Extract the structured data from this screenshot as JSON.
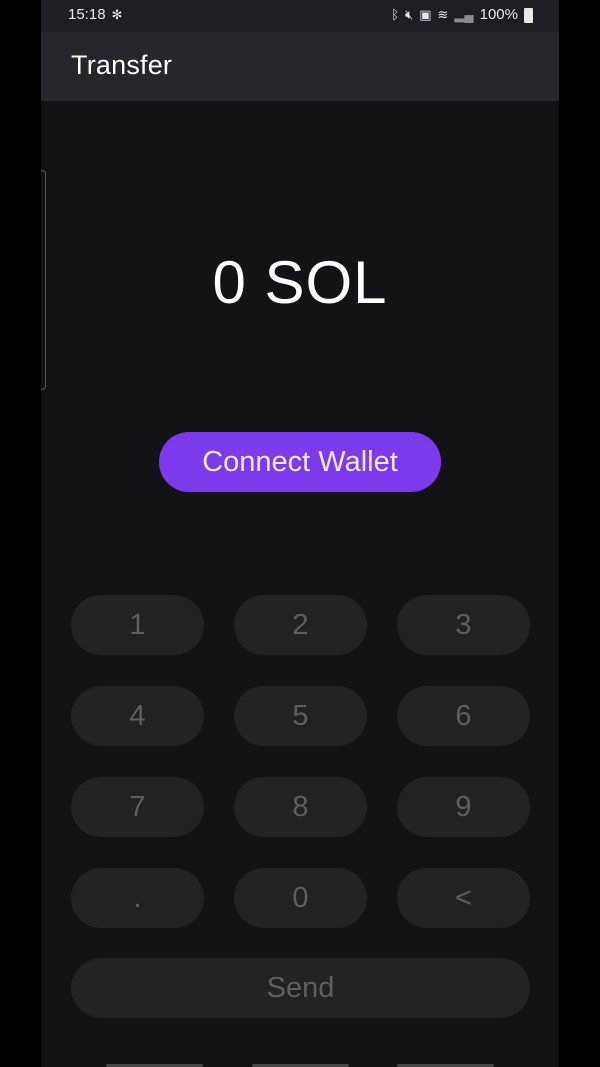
{
  "status_bar": {
    "time": "15:18",
    "left_icon": "pinwheel-icon",
    "battery_text": "100%",
    "icons": [
      "bluetooth-icon",
      "mute-icon",
      "sim-lock-icon",
      "wifi-icon",
      "signal-icon",
      "battery-icon"
    ]
  },
  "app_bar": {
    "title": "Transfer"
  },
  "balance": {
    "text": "0 SOL"
  },
  "connect_button": {
    "label": "Connect Wallet",
    "color": "#7c3aed"
  },
  "keypad": {
    "keys": [
      "1",
      "2",
      "3",
      "4",
      "5",
      "6",
      "7",
      "8",
      "9",
      ".",
      "0",
      "<"
    ]
  },
  "send_button": {
    "label": "Send"
  }
}
